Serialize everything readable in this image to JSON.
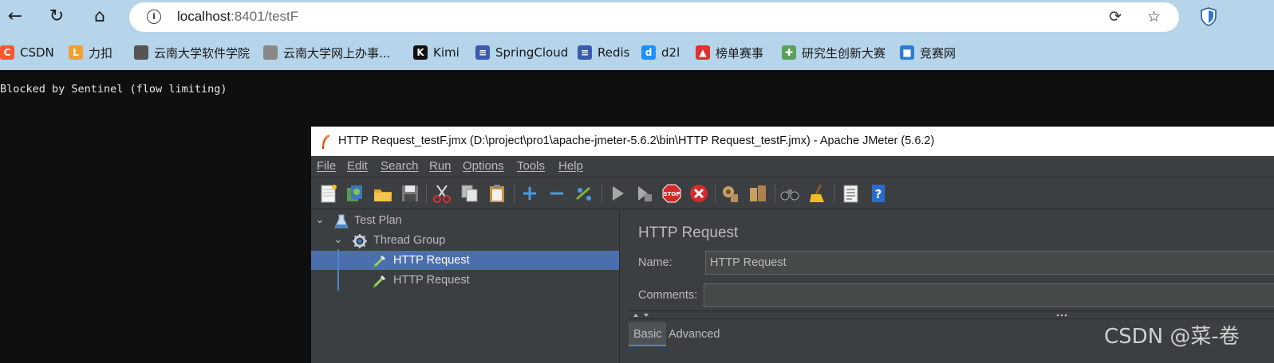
{
  "browser": {
    "url_host": "localhost",
    "url_rest": ":8401/testF",
    "bookmarks": [
      {
        "label": "CSDN",
        "icon": "csdn-logo-icon",
        "color": "#fc5531"
      },
      {
        "label": "力扣",
        "icon": "leetcode-icon",
        "color": "#f0a030"
      },
      {
        "label": "云南大学软件学院",
        "icon": "page-icon",
        "color": "#555555"
      },
      {
        "label": "云南大学网上办事...",
        "icon": "house-icon",
        "color": "#888888"
      },
      {
        "label": "Kimi",
        "icon": "kimi-icon",
        "color": "#111111"
      },
      {
        "label": "SpringCloud",
        "icon": "doc-icon",
        "color": "#3b5bb0"
      },
      {
        "label": "Redis",
        "icon": "doc-icon",
        "color": "#3b5bb0"
      },
      {
        "label": "d2l",
        "icon": "d2l-icon",
        "color": "#1e90ff"
      },
      {
        "label": "榜单赛事",
        "icon": "ranking-icon",
        "color": "#e03030"
      },
      {
        "label": "研究生创新大赛",
        "icon": "puzzle-icon",
        "color": "#5aa05a"
      },
      {
        "label": "竞赛网",
        "icon": "cube-icon",
        "color": "#2b7cd3"
      }
    ]
  },
  "page": {
    "message": "Blocked by Sentinel (flow limiting)"
  },
  "jmeter": {
    "title": "HTTP Request_testF.jmx (D:\\project\\pro1\\apache-jmeter-5.6.2\\bin\\HTTP Request_testF.jmx) - Apache JMeter (5.6.2)",
    "menus": [
      "File",
      "Edit",
      "Search",
      "Run",
      "Options",
      "Tools",
      "Help"
    ],
    "tree": {
      "test_plan": "Test Plan",
      "thread_group": "Thread Group",
      "request_1": "HTTP Request",
      "request_2": "HTTP Request"
    },
    "panel": {
      "title": "HTTP Request",
      "name_label": "Name:",
      "name_value": "HTTP Request",
      "comments_label": "Comments:",
      "comments_value": "",
      "tab_basic": "Basic",
      "tab_advanced": "Advanced"
    }
  },
  "watermark": "CSDN @菜-卷"
}
